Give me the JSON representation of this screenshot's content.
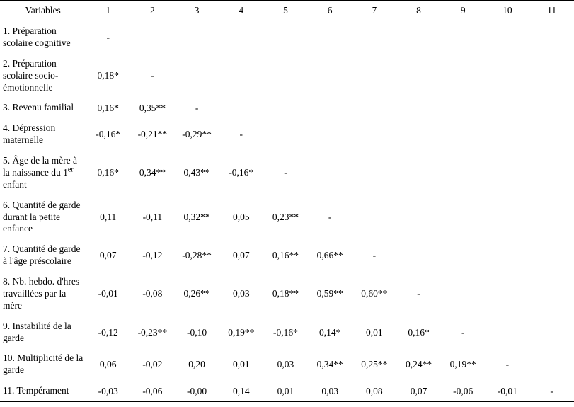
{
  "table": {
    "header_variable": "Variables",
    "col_labels": [
      "1",
      "2",
      "3",
      "4",
      "5",
      "6",
      "7",
      "8",
      "9",
      "10",
      "11"
    ],
    "rows": [
      {
        "label": "1. Préparation scolaire cognitive",
        "cells": [
          "-",
          "",
          "",
          "",
          "",
          "",
          "",
          "",
          "",
          "",
          ""
        ]
      },
      {
        "label": "2. Préparation scolaire socio-émotionnelle",
        "cells": [
          "0,18*",
          "-",
          "",
          "",
          "",
          "",
          "",
          "",
          "",
          "",
          ""
        ]
      },
      {
        "label": "3. Revenu familial",
        "cells": [
          "0,16*",
          "0,35**",
          "-",
          "",
          "",
          "",
          "",
          "",
          "",
          "",
          ""
        ]
      },
      {
        "label": "4. Dépression maternelle",
        "cells": [
          "-0,16*",
          "-0,21**",
          "-0,29**",
          "-",
          "",
          "",
          "",
          "",
          "",
          "",
          ""
        ]
      },
      {
        "label": "5. Âge de la mère à la naissance du 1<sup>er</sup> enfant",
        "cells": [
          "0,16*",
          "0,34**",
          "0,43**",
          "-0,16*",
          "-",
          "",
          "",
          "",
          "",
          "",
          ""
        ]
      },
      {
        "label": "6. Quantité de garde durant la petite enfance",
        "cells": [
          "0,11",
          "-0,11",
          "0,32**",
          "0,05",
          "0,23**",
          "-",
          "",
          "",
          "",
          "",
          ""
        ]
      },
      {
        "label": "7. Quantité de garde à l'âge préscolaire",
        "cells": [
          "0,07",
          "-0,12",
          "-0,28**",
          "0,07",
          "0,16**",
          "0,66**",
          "-",
          "",
          "",
          "",
          ""
        ]
      },
      {
        "label": "8. Nb. hebdo. d'hres travaillées par la mère",
        "cells": [
          "-0,01",
          "-0,08",
          "0,26**",
          "0,03",
          "0,18**",
          "0,59**",
          "0,60**",
          "-",
          "",
          "",
          ""
        ]
      },
      {
        "label": "9. Instabilité de la garde",
        "cells": [
          "-0,12",
          "-0,23**",
          "-0,10",
          "0,19**",
          "-0,16*",
          "0,14*",
          "0,01",
          "0,16*",
          "-",
          "",
          ""
        ]
      },
      {
        "label": "10. Multiplicité de la garde",
        "cells": [
          "0,06",
          "-0,02",
          "0,20",
          "0,01",
          "0,03",
          "0,34**",
          "0,25**",
          "0,24**",
          "0,19**",
          "-",
          ""
        ]
      },
      {
        "label": "11. Tempérament",
        "cells": [
          "-0,03",
          "-0,06",
          "-0,00",
          "0,14",
          "0,01",
          "0,03",
          "0,08",
          "0,07",
          "-0,06",
          "-0,01",
          "-"
        ]
      }
    ]
  }
}
